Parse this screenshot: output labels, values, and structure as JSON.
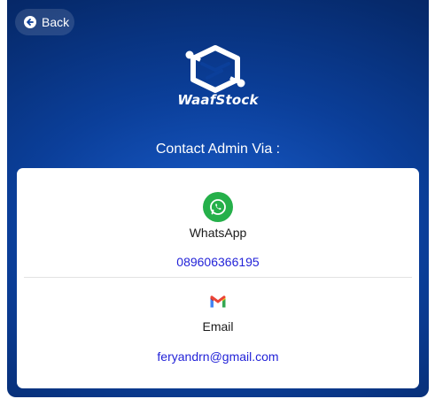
{
  "nav": {
    "back_label": "Back"
  },
  "brand": {
    "name": "WaafStock"
  },
  "contact": {
    "title": "Contact Admin Via :",
    "whatsapp": {
      "label": "WhatsApp",
      "value": "089606366195",
      "icon": "whatsapp-icon"
    },
    "email": {
      "label": "Email",
      "value": "feryandrn@gmail.com",
      "icon": "gmail-icon"
    }
  },
  "colors": {
    "panel_dark": "#041f55",
    "panel_light": "#1a5fd0",
    "link": "#2323d8",
    "whatsapp_green": "#25b04a"
  }
}
